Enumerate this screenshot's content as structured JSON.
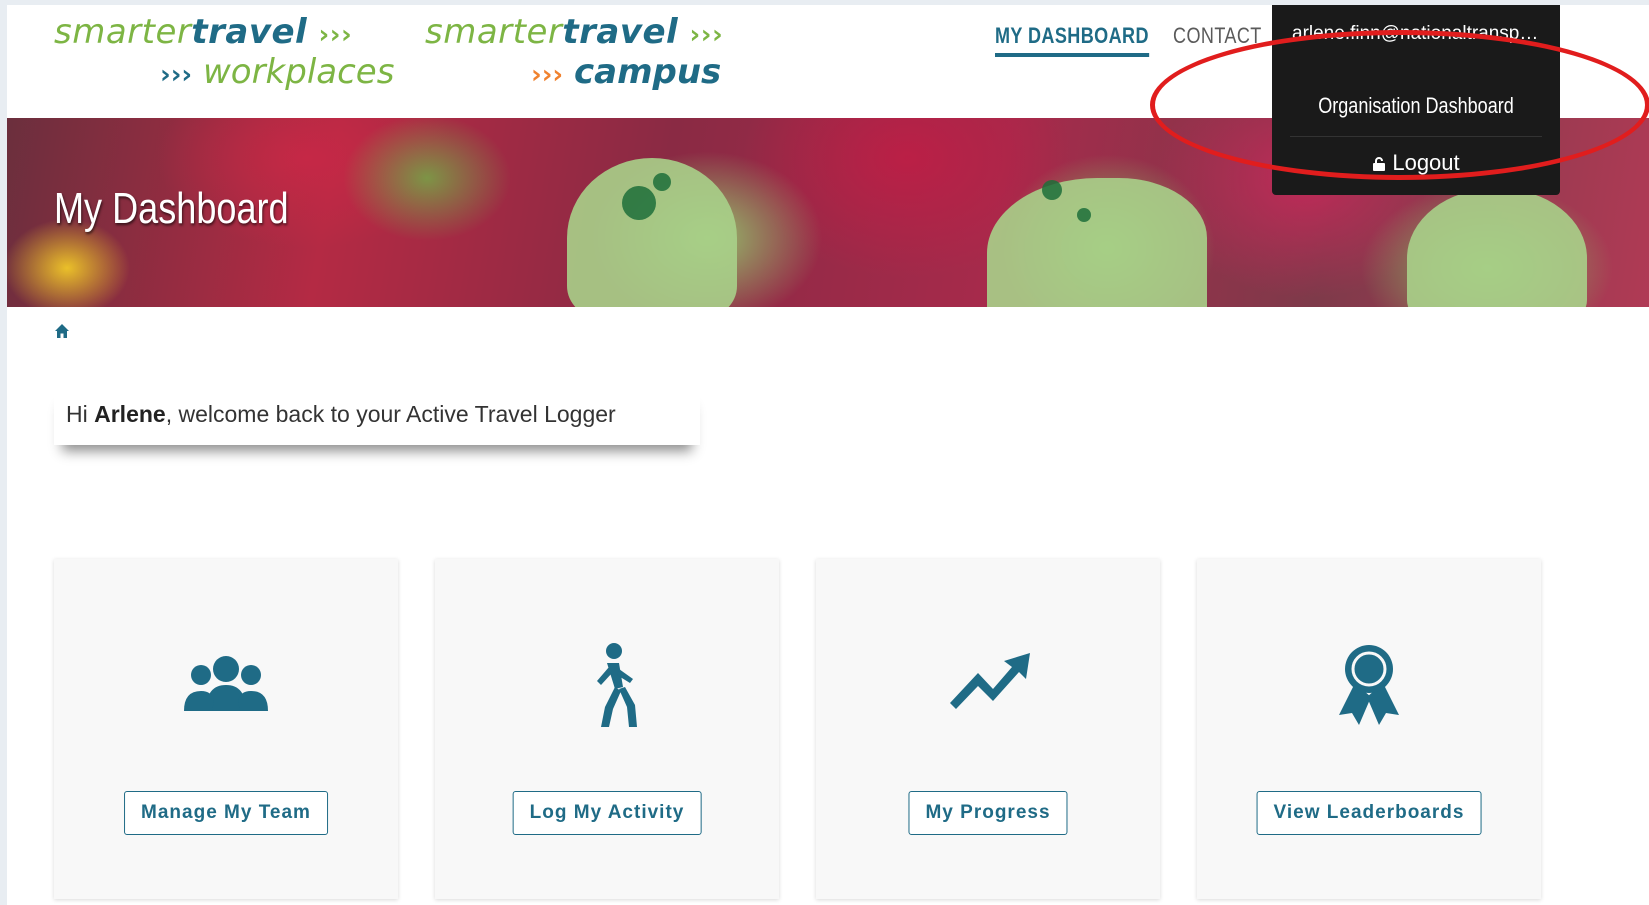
{
  "header": {
    "logo1": {
      "line1_light": "smarter",
      "line1_bold": "travel",
      "line1_arrows": "›››",
      "line2_arrows": "›››",
      "line2_word": "workplaces"
    },
    "logo2": {
      "line1_light": "smarter",
      "line1_bold": "travel",
      "line1_arrows": "›››",
      "line2_arrows": "›››",
      "line2_word": "campus"
    },
    "nav": {
      "dashboard": "MY DASHBOARD",
      "contact": "CONTACT"
    },
    "user_menu": {
      "email": "arlene.finn@nationaltransport...",
      "items": {
        "org_dashboard": "Organisation Dashboard",
        "logout": "Logout"
      }
    }
  },
  "banner": {
    "title": "My Dashboard"
  },
  "welcome": {
    "prefix": "Hi ",
    "name": "Arlene",
    "suffix": ", welcome back to your Active Travel Logger"
  },
  "cards": [
    {
      "icon": "team-icon",
      "label": "Manage My Team"
    },
    {
      "icon": "walking-person-icon",
      "label": "Log My Activity"
    },
    {
      "icon": "trending-up-icon",
      "label": "My Progress"
    },
    {
      "icon": "award-ribbon-icon",
      "label": "View Leaderboards"
    }
  ],
  "colors": {
    "brand_blue": "#1f6b86",
    "brand_green": "#7db544",
    "brand_orange": "#f0822f",
    "menu_bg": "#1a1a1a",
    "highlight": "#e11d1d"
  }
}
